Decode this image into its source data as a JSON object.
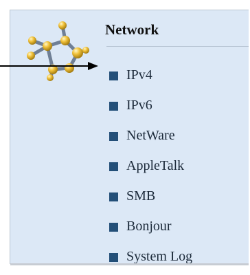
{
  "panel": {
    "title": "Network",
    "logo_icon": "network-molecule-icon",
    "items": [
      {
        "label": "IPv4"
      },
      {
        "label": "IPv6"
      },
      {
        "label": "NetWare"
      },
      {
        "label": "AppleTalk"
      },
      {
        "label": "SMB"
      },
      {
        "label": "Bonjour"
      },
      {
        "label": "System Log"
      }
    ]
  },
  "colors": {
    "panel_background": "#dce8f6",
    "bullet": "#234f78",
    "arrow": "#000000",
    "logo_nodes": "#f2c23a"
  },
  "annotation": {
    "arrow_target": "IPv4"
  }
}
